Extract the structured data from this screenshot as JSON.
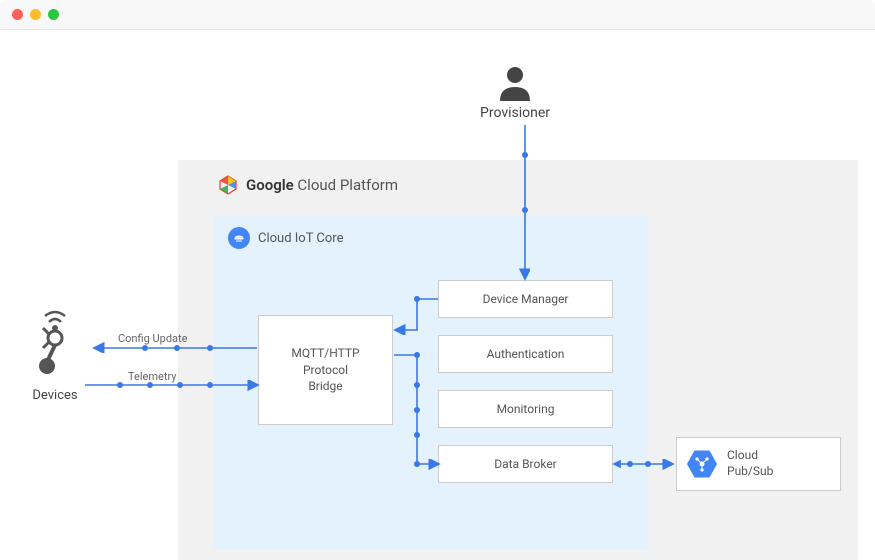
{
  "chrome": {
    "dots": [
      "red",
      "yellow",
      "green"
    ]
  },
  "provisioner": {
    "label": "Provisioner"
  },
  "gcp": {
    "title_prefix": "Google",
    "title_suffix": " Cloud Platform"
  },
  "iot": {
    "title": "Cloud IoT Core"
  },
  "nodes": {
    "bridge": "MQTT/HTTP\nProtocol\nBridge",
    "device_manager": "Device Manager",
    "authentication": "Authentication",
    "monitoring": "Monitoring",
    "data_broker": "Data Broker"
  },
  "pubsub": {
    "label": "Cloud\nPub/Sub"
  },
  "devices": {
    "label": "Devices"
  },
  "edges": {
    "config_update": "Config Update",
    "telemetry": "Telemetry"
  },
  "colors": {
    "accent": "#3b78e7",
    "gcp_bg": "#f1f1f1",
    "iot_bg": "#e3f2fd"
  }
}
